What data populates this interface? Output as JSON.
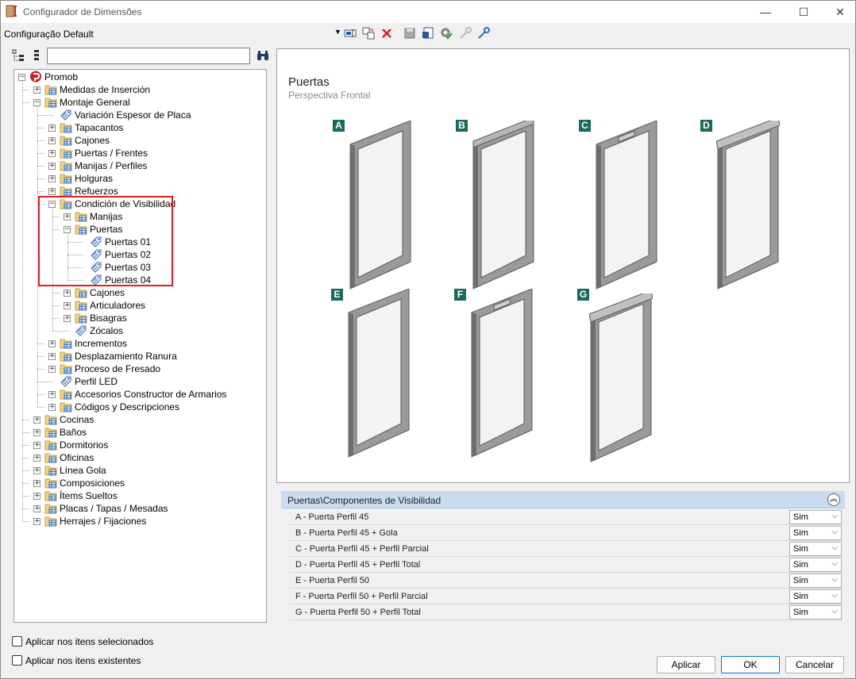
{
  "window": {
    "title": "Configurador de Dimensões",
    "minimize_glyph": "—",
    "maximize_glyph": "☐",
    "close_glyph": "✕"
  },
  "config": {
    "name": "Configuração Default",
    "dropdown_glyph": "▼"
  },
  "search": {
    "value": "",
    "binoculars_glyph": "⚲"
  },
  "tree": [
    {
      "label": "Promob",
      "depth": 0,
      "expander": "−",
      "icon": "promob-logo-icon"
    },
    {
      "label": "Medidas de Inserción",
      "depth": 1,
      "expander": "+",
      "icon": "folder-table-icon"
    },
    {
      "label": "Montaje General",
      "depth": 1,
      "expander": "−",
      "icon": "folder-table-icon"
    },
    {
      "label": "Variación Espesor de Placa",
      "depth": 2,
      "expander": "",
      "icon": "tag-icon"
    },
    {
      "label": "Tapacantos",
      "depth": 2,
      "expander": "+",
      "icon": "folder-table-icon"
    },
    {
      "label": "Cajones",
      "depth": 2,
      "expander": "+",
      "icon": "folder-table-icon"
    },
    {
      "label": "Puertas / Frentes",
      "depth": 2,
      "expander": "+",
      "icon": "folder-table-icon"
    },
    {
      "label": "Manijas / Perfiles",
      "depth": 2,
      "expander": "+",
      "icon": "folder-table-icon"
    },
    {
      "label": "Holguras",
      "depth": 2,
      "expander": "+",
      "icon": "folder-table-icon"
    },
    {
      "label": "Refuerzos",
      "depth": 2,
      "expander": "+",
      "icon": "folder-table-icon"
    },
    {
      "label": "Condición de Visibilidad",
      "depth": 2,
      "expander": "−",
      "icon": "folder-table-icon"
    },
    {
      "label": "Manijas",
      "depth": 3,
      "expander": "+",
      "icon": "folder-table-icon"
    },
    {
      "label": "Puertas",
      "depth": 3,
      "expander": "−",
      "icon": "folder-table-icon"
    },
    {
      "label": "Puertas 01",
      "depth": 4,
      "expander": "",
      "icon": "tag-icon"
    },
    {
      "label": "Puertas 02",
      "depth": 4,
      "expander": "",
      "icon": "tag-icon"
    },
    {
      "label": "Puertas 03",
      "depth": 4,
      "expander": "",
      "icon": "tag-icon"
    },
    {
      "label": "Puertas 04",
      "depth": 4,
      "expander": "",
      "icon": "tag-icon"
    },
    {
      "label": "Cajones",
      "depth": 3,
      "expander": "+",
      "icon": "folder-table-icon"
    },
    {
      "label": "Articuladores",
      "depth": 3,
      "expander": "+",
      "icon": "folder-table-icon"
    },
    {
      "label": "Bisagras",
      "depth": 3,
      "expander": "+",
      "icon": "folder-table-icon"
    },
    {
      "label": "Zócalos",
      "depth": 3,
      "expander": "",
      "icon": "tag-icon"
    },
    {
      "label": "Incrementos",
      "depth": 2,
      "expander": "+",
      "icon": "folder-table-icon"
    },
    {
      "label": "Desplazamiento Ranura",
      "depth": 2,
      "expander": "+",
      "icon": "folder-table-icon"
    },
    {
      "label": "Proceso de Fresado",
      "depth": 2,
      "expander": "+",
      "icon": "folder-table-icon"
    },
    {
      "label": "Perfil LED",
      "depth": 2,
      "expander": "",
      "icon": "tag-icon"
    },
    {
      "label": "Accesorios Constructor de Armarios",
      "depth": 2,
      "expander": "+",
      "icon": "folder-table-icon"
    },
    {
      "label": "Códigos y Descripciones",
      "depth": 2,
      "expander": "+",
      "icon": "folder-table-icon"
    },
    {
      "label": "Cocinas",
      "depth": 1,
      "expander": "+",
      "icon": "folder-table-icon"
    },
    {
      "label": "Baños",
      "depth": 1,
      "expander": "+",
      "icon": "folder-table-icon"
    },
    {
      "label": "Dormitorios",
      "depth": 1,
      "expander": "+",
      "icon": "folder-table-icon"
    },
    {
      "label": "Oficinas",
      "depth": 1,
      "expander": "+",
      "icon": "folder-table-icon"
    },
    {
      "label": "Línea Gola",
      "depth": 1,
      "expander": "+",
      "icon": "folder-table-icon"
    },
    {
      "label": "Composiciones",
      "depth": 1,
      "expander": "+",
      "icon": "folder-table-icon"
    },
    {
      "label": "Ítems Sueltos",
      "depth": 1,
      "expander": "+",
      "icon": "folder-table-icon"
    },
    {
      "label": "Placas / Tapas / Mesadas",
      "depth": 1,
      "expander": "+",
      "icon": "folder-table-icon"
    },
    {
      "label": "Herrajes / Fijaciones",
      "depth": 1,
      "expander": "+",
      "icon": "folder-table-icon"
    }
  ],
  "preview": {
    "title": "Puertas",
    "subtitle": "Perspectiva Frontal",
    "doors": [
      {
        "letter": "A",
        "variant": "perfil45"
      },
      {
        "letter": "B",
        "variant": "perfil45-gola"
      },
      {
        "letter": "C",
        "variant": "perfil45-parcial"
      },
      {
        "letter": "D",
        "variant": "perfil45-total"
      },
      {
        "letter": "E",
        "variant": "perfil50"
      },
      {
        "letter": "F",
        "variant": "perfil50-parcial"
      },
      {
        "letter": "G",
        "variant": "perfil50-total"
      }
    ]
  },
  "properties": {
    "header": "Puertas\\Componentes de Visibilidad",
    "collapse_glyph": "︽",
    "rows": [
      {
        "label": "A - Puerta Perfil 45",
        "value": "Sim"
      },
      {
        "label": "B - Puerta Perfil 45 + Gola",
        "value": "Sim"
      },
      {
        "label": "C - Puerta Perfil 45 + Perfil Parcial",
        "value": "Sim"
      },
      {
        "label": "D - Puerta Perfil 45 + Perfil Total",
        "value": "Sim"
      },
      {
        "label": "E - Puerta Perfil 50",
        "value": "Sim"
      },
      {
        "label": "F - Puerta Perfil 50 + Perfil Parcial",
        "value": "Sim"
      },
      {
        "label": "G - Puerta Perfil 50 + Perfil Total",
        "value": "Sim"
      }
    ],
    "select_arrow": "⌵"
  },
  "options": {
    "apply_selected": "Aplicar nos itens selecionados",
    "apply_existing": "Aplicar nos itens existentes"
  },
  "buttons": {
    "apply": "Aplicar",
    "ok": "OK",
    "cancel": "Cancelar"
  },
  "colors": {
    "accent": "#0078d7",
    "letter_badge": "#1a6b5f",
    "highlight": "#e02020",
    "header_bg": "#c9dcef"
  }
}
